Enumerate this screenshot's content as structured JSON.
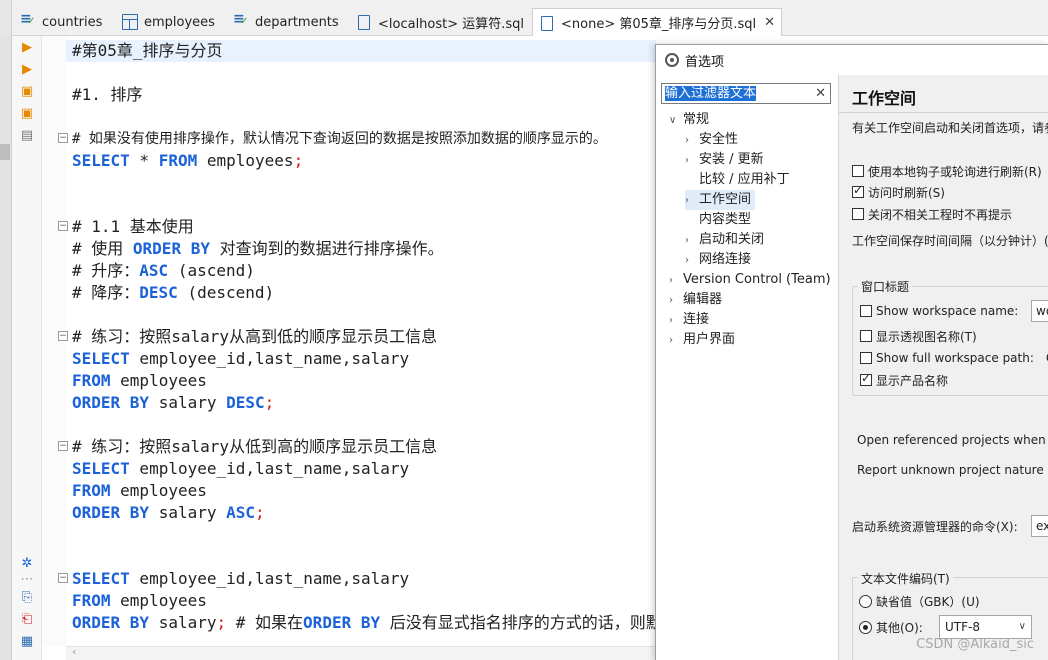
{
  "tabs": [
    {
      "label": "countries",
      "icon": "sql-file-icon"
    },
    {
      "label": "employees",
      "icon": "table-icon"
    },
    {
      "label": "departments",
      "icon": "sql-file-icon"
    },
    {
      "label": "<localhost> 运算符.sql",
      "icon": "script-icon"
    },
    {
      "label": "<none> 第05章_排序与分页.sql",
      "icon": "script-icon",
      "active": true
    }
  ],
  "tab_close": "✕",
  "editor": {
    "lines": [
      "#第05章_排序与分页",
      "#1. 排序",
      "# 如果没有使用排序操作，默认情况下查询返回的数据是按照添加数据的顺序显示的。",
      "SELECT * FROM employees;",
      "# 1.1 基本使用",
      "# 使用 ORDER BY 对查询到的数据进行排序操作。",
      "# 升序：ASC (ascend)",
      "# 降序：DESC (descend)",
      "# 练习：按照salary从高到低的顺序显示员工信息",
      "SELECT employee_id,last_name,salary",
      "FROM employees",
      "ORDER BY salary DESC;",
      "# 练习：按照salary从低到高的顺序显示员工信息",
      "SELECT employee_id,last_name,salary",
      "FROM employees",
      "ORDER BY salary ASC;",
      "SELECT employee_id,last_name,salary",
      "FROM employees",
      "ORDER BY salary; # 如果在ORDER BY 后没有显式指名排序的方式的话，则默认"
    ]
  },
  "dialog": {
    "title": "首选项",
    "filter_text": "输入过滤器文本",
    "clear_icon": "✕",
    "nav": [
      {
        "label": "常规",
        "expanded": true
      },
      {
        "label": "安全性"
      },
      {
        "label": "安装 / 更新"
      },
      {
        "label": "比较 / 应用补丁"
      },
      {
        "label": "工作空间",
        "selected": true
      },
      {
        "label": "内容类型"
      },
      {
        "label": "启动和关闭"
      },
      {
        "label": "网络连接"
      },
      {
        "label": "Version Control (Team)"
      },
      {
        "label": "编辑器"
      },
      {
        "label": "连接"
      },
      {
        "label": "用户界面"
      }
    ],
    "pane": {
      "title": "工作空间",
      "description": "有关工作空间启动和关闭首选项，请参",
      "checkboxes": [
        {
          "label": "使用本地钩子或轮询进行刷新(R)",
          "checked": false
        },
        {
          "label": "访问时刷新(S)",
          "checked": true
        },
        {
          "label": "关闭不相关工程时不再提示",
          "checked": false
        }
      ],
      "save_interval_label": "工作空间保存时间间隔（以分钟计）(",
      "window_title_group": "窗口标题",
      "window_title_options": [
        {
          "label": "Show workspace name:",
          "checked": false,
          "value": "wo"
        },
        {
          "label": "显示透视图名称(T)",
          "checked": false
        },
        {
          "label": "Show full workspace path:",
          "checked": false,
          "value": "C"
        },
        {
          "label": "显示产品名称",
          "checked": true
        }
      ],
      "open_referenced": "Open referenced projects when a",
      "report_unknown": "Report unknown project nature a",
      "explorer_cmd_label": "启动系统资源管理器的命令(X):",
      "explorer_cmd_value": "ex",
      "encoding_group": "文本文件编码(T)",
      "encoding_default": "缺省值（GBK）(U)",
      "encoding_other": "其他(O):",
      "encoding_value": "UTF-8",
      "encoding_selected": "other"
    }
  },
  "watermark": "CSDN @Alkaid_sic"
}
